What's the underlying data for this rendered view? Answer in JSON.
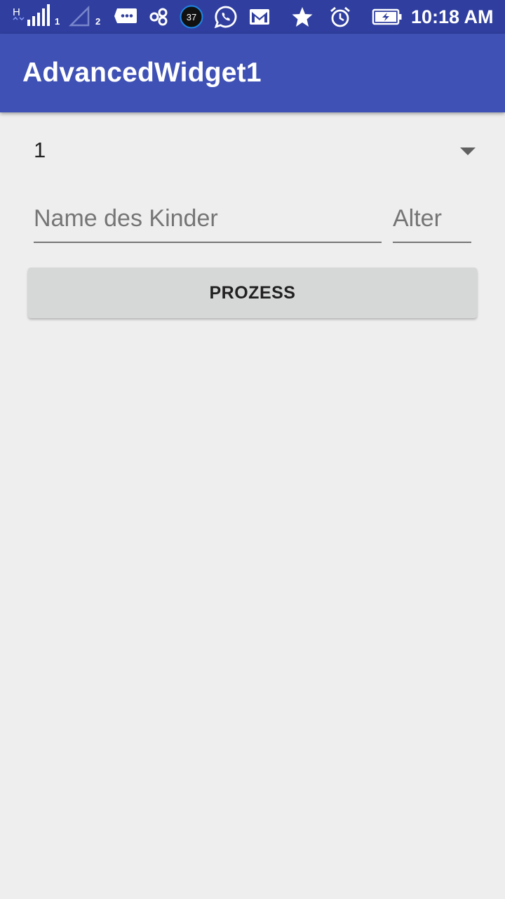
{
  "status_bar": {
    "network_type": "H",
    "sim1_label": "1",
    "sim2_label": "2",
    "notification_badge": "37",
    "time": "10:18 AM",
    "icons": [
      "signal-icon",
      "signal-empty-icon",
      "message-icon",
      "link-icon",
      "notification-badge-icon",
      "whatsapp-icon",
      "gmail-icon",
      "star-icon",
      "alarm-icon",
      "battery-charging-icon"
    ]
  },
  "app_bar": {
    "title": "AdvancedWidget1",
    "color": "#3f51b5",
    "status_color": "#303f9f"
  },
  "form": {
    "spinner_value": "1",
    "name_placeholder": "Name des Kinder",
    "name_value": "",
    "age_placeholder": "Alter",
    "age_value": "",
    "process_label": "PROZESS"
  }
}
